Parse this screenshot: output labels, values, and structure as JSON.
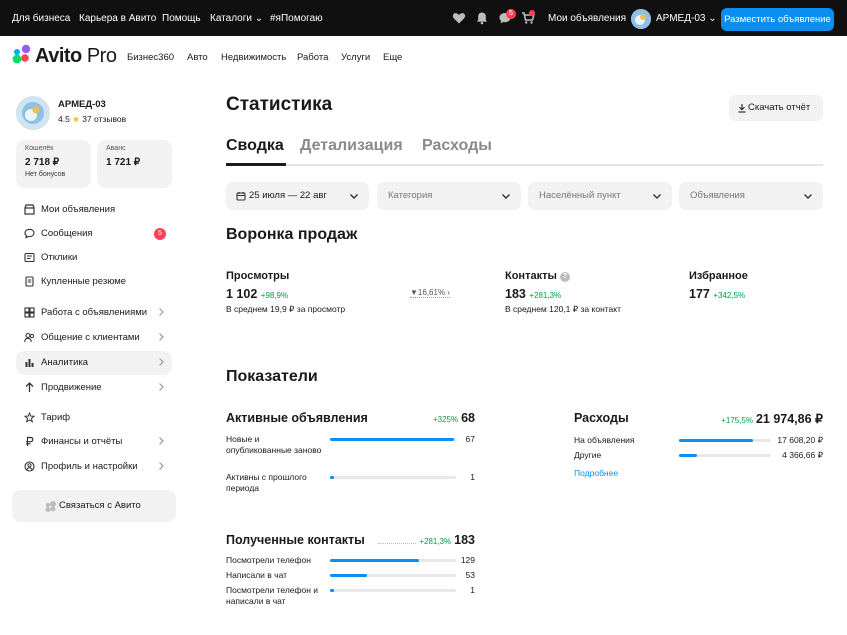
{
  "topbar": {
    "links": [
      "Для бизнеса",
      "Карьера в Авито",
      "Помощь",
      "Каталоги",
      "#яПомогаю"
    ],
    "catalog_chevron": "⌄",
    "icons": [
      "heart-icon",
      "bell-icon",
      "chat-icon",
      "cart-icon"
    ],
    "chat_badge": "5",
    "my_ads": "Мои объявления",
    "user_name": "АРМЕД-03",
    "user_chevron": "⌄",
    "post_button": "Разместить объявление"
  },
  "header": {
    "logo_main": "Avito",
    "logo_pro": "Pro",
    "nav": [
      "Бизнес360",
      "Авто",
      "Недвижимость",
      "Работа",
      "Услуги",
      "Еще"
    ]
  },
  "profile": {
    "name": "АРМЕД-03",
    "rating": "4.5",
    "reviews": "37 отзывов"
  },
  "wallet": {
    "label": "Кошелёк",
    "value": "2 718 ₽",
    "note": "Нет бонусов"
  },
  "advance": {
    "label": "Аванс",
    "value": "1 721 ₽"
  },
  "sidebar": {
    "items": [
      {
        "label": "Мои объявления",
        "icon": "store-icon"
      },
      {
        "label": "Сообщения",
        "icon": "message-icon",
        "count": "5"
      },
      {
        "label": "Отклики",
        "icon": "responses-icon"
      },
      {
        "label": "Купленные резюме",
        "icon": "resume-icon"
      },
      {
        "label": "Работа с объявлениями",
        "icon": "ads-work-icon"
      },
      {
        "label": "Общение с клиентами",
        "icon": "clients-icon"
      },
      {
        "label": "Аналитика",
        "icon": "analytics-icon"
      },
      {
        "label": "Продвижение",
        "icon": "promo-icon"
      },
      {
        "label": "Тариф",
        "icon": "tariff-icon"
      },
      {
        "label": "Финансы и отчёты",
        "icon": "ruble-icon"
      },
      {
        "label": "Профиль и настройки",
        "icon": "profile-icon"
      }
    ],
    "contact_button": "Связаться с Авито"
  },
  "main": {
    "title": "Статистика",
    "download": "Скачать отчёт",
    "tabs": [
      "Сводка",
      "Детализация",
      "Расходы"
    ],
    "filters": [
      "25 июля — 22 авг",
      "Категория",
      "Населённый пункт",
      "Объявления"
    ],
    "funnel": {
      "heading": "Воронка продаж",
      "views": {
        "name": "Просмотры",
        "value": "1 102",
        "delta": "+98,9%",
        "note": "В среднем 19,9 ₽ за просмотр"
      },
      "conversion": "16,61%",
      "contacts": {
        "name": "Контакты",
        "value": "183",
        "delta": "+281,3%",
        "note": "В среднем 120,1 ₽ за контакт"
      },
      "favorites": {
        "name": "Избранное",
        "value": "177",
        "delta": "+342,5%"
      }
    },
    "indicators": {
      "heading": "Показатели",
      "active": {
        "title": "Активные объявления",
        "delta": "+325%",
        "total": "68",
        "rows": [
          {
            "label": "Новые и опубликованные заново",
            "value": "67",
            "fraction": 0.985
          },
          {
            "label": "Активны с прошлого периода",
            "value": "1",
            "fraction": 0.015
          }
        ]
      },
      "expenses": {
        "title": "Расходы",
        "delta": "+175,5%",
        "total": "21 974,86 ₽",
        "rows": [
          {
            "label": "На объявления",
            "value": "17 608,20 ₽",
            "fraction": 0.8
          },
          {
            "label": "Другие",
            "value": "4 366,66 ₽",
            "fraction": 0.2
          }
        ],
        "more": "Подробнее"
      },
      "contacts": {
        "title": "Полученные контакты",
        "delta": "+281,3%",
        "total": "183",
        "rows": [
          {
            "label": "Посмотрели телефон",
            "value": "129",
            "fraction": 0.705
          },
          {
            "label": "Написали в чат",
            "value": "53",
            "fraction": 0.29
          },
          {
            "label": "Посмотрели телефон и написали в чат",
            "value": "1",
            "fraction": 0.0055
          }
        ]
      }
    }
  },
  "colors": {
    "accent": "#0a8ff0",
    "positive": "#00a046",
    "badge": "#ff4053"
  }
}
